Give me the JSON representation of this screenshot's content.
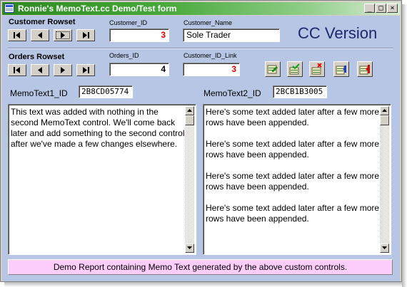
{
  "window": {
    "title": "Ronnie's MemoText.cc Demo/Test form"
  },
  "title_buttons": {
    "minimize": "_",
    "maximize": "□",
    "close": "×"
  },
  "customer": {
    "section_label": "Customer Rowset",
    "id_label": "Customer_ID",
    "id_value": "3",
    "name_label": "Customer_Name",
    "name_value": "Sole Trader"
  },
  "cc_version": "CC  Version",
  "orders": {
    "section_label": "Orders Rowset",
    "id_label": "Orders_ID",
    "id_value": "4",
    "link_label": "Customer_ID_Link",
    "link_value": "3"
  },
  "memo1": {
    "id_label": "MemoText1_ID",
    "id_value": "2B8CD05774",
    "lines": [
      "This text was added with nothing in the",
      "second MemoText control. We'll come back",
      "later and add something to the second control",
      "after we've made a few changes elsewhere."
    ]
  },
  "memo2": {
    "id_label": "MemoText2_ID",
    "id_value": "2BCB1B3005",
    "lines": [
      "Here's some text added later after a few more",
      "rows have been appended.",
      "",
      "Here's some text added later after a few more",
      "rows have been appended.",
      "",
      "Here's some text added later after a few more",
      "rows have been appended.",
      "",
      "Here's some text added later after a few more",
      "rows have been appended."
    ]
  },
  "report_button": "Demo Report containing Memo Text generated by the above custom controls.",
  "icons": {
    "nav": [
      "first-record-icon",
      "previous-record-icon",
      "next-record-icon",
      "last-record-icon"
    ],
    "toolbar": [
      "edit-record-icon",
      "save-record-icon",
      "delete-record-icon",
      "new-record-icon",
      "undo-record-icon"
    ]
  },
  "colors": {
    "form_bg": "#b6c6e4",
    "titlebar": "#2c8a20",
    "report_bg": "#fdcdfc",
    "id_value_red": "#e00000",
    "cc_text": "#1a2a6c"
  }
}
